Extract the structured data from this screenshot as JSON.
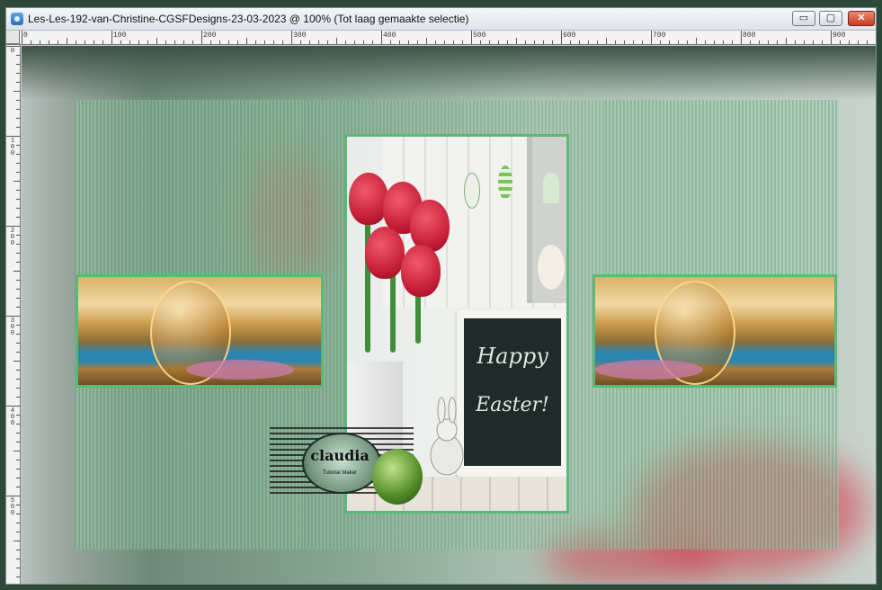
{
  "window": {
    "title": "Les-Les-192-van-Christine-CGSFDesigns-23-03-2023 @ 100% (Tot laag gemaakte selectie)",
    "buttons": {
      "minimize": "▭",
      "maximize": "▢",
      "close": "✕"
    }
  },
  "ruler": {
    "top_labels": [
      "0",
      "100",
      "200",
      "300",
      "400",
      "500",
      "600",
      "700",
      "800",
      "900"
    ],
    "left_labels": [
      "0",
      "100",
      "200",
      "300",
      "400",
      "500"
    ]
  },
  "canvas": {
    "board_text_line1": "Happy",
    "board_text_line2": "Easter!",
    "watermark_text": "claudia",
    "watermark_sub": "Tutorial Maker"
  },
  "colors": {
    "accent_border": "#5db779",
    "close_button": "#c63b24"
  },
  "icons": {
    "app": "psp-image-icon",
    "minimize": "minimize-icon",
    "maximize": "maximize-icon",
    "close": "close-icon"
  }
}
